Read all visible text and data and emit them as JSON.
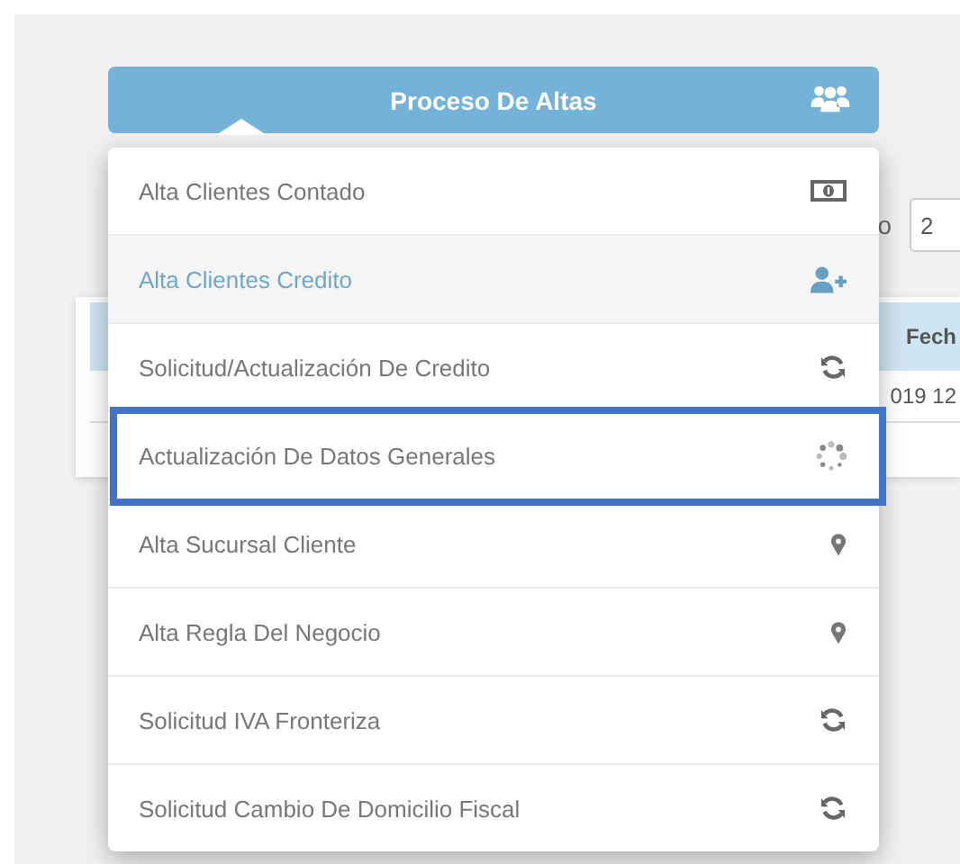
{
  "background": {
    "filter_label": "o",
    "filter_value": "2",
    "table": {
      "columns": [
        "Fech"
      ],
      "rows": [
        [
          "019 12"
        ]
      ]
    }
  },
  "menu": {
    "title": "Proceso De Altas",
    "items": [
      {
        "label": "Alta Clientes Contado",
        "kind": "money",
        "selected": false,
        "outlined": false
      },
      {
        "label": "Alta Clientes Credito",
        "kind": "user-plus",
        "selected": true,
        "outlined": false
      },
      {
        "label": "Solicitud/Actualización De Credito",
        "kind": "sync",
        "selected": false,
        "outlined": false
      },
      {
        "label": "Actualización De Datos Generales",
        "kind": "spinner",
        "selected": false,
        "outlined": true
      },
      {
        "label": "Alta Sucursal Cliente",
        "kind": "marker",
        "selected": false,
        "outlined": false
      },
      {
        "label": "Alta Regla Del Negocio",
        "kind": "marker",
        "selected": false,
        "outlined": false
      },
      {
        "label": "Solicitud IVA Fronteriza",
        "kind": "sync",
        "selected": false,
        "outlined": false
      },
      {
        "label": "Solicitud Cambio De Domicilio Fiscal",
        "kind": "sync",
        "selected": false,
        "outlined": false
      }
    ]
  }
}
